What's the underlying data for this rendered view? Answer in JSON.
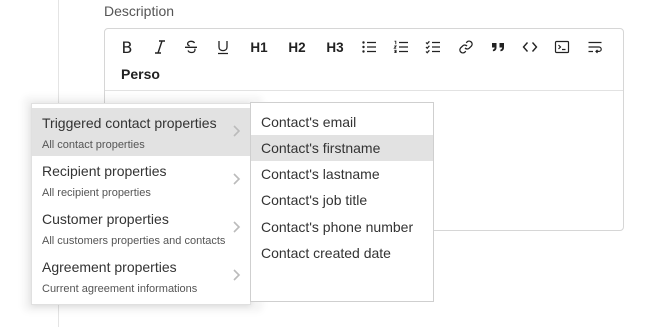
{
  "field": {
    "label": "Description"
  },
  "toolbar": {
    "buttons": [
      {
        "icon": "bold-icon",
        "label": "B"
      },
      {
        "icon": "italic-icon",
        "label": ""
      },
      {
        "icon": "strikethrough-icon",
        "label": ""
      },
      {
        "icon": "underline-icon",
        "label": ""
      },
      {
        "icon": "heading1",
        "label": "H1"
      },
      {
        "icon": "heading2",
        "label": "H2"
      },
      {
        "icon": "heading3",
        "label": "H3"
      },
      {
        "icon": "bullet-list-icon",
        "label": ""
      },
      {
        "icon": "numbered-list-icon",
        "label": ""
      },
      {
        "icon": "checklist-icon",
        "label": ""
      },
      {
        "icon": "link-icon",
        "label": ""
      },
      {
        "icon": "quote-icon",
        "label": ""
      },
      {
        "icon": "code-icon",
        "label": ""
      },
      {
        "icon": "code-block-icon",
        "label": ""
      },
      {
        "icon": "text-wrap-icon",
        "label": ""
      }
    ],
    "perso_label": "Perso"
  },
  "menu": {
    "items": [
      {
        "title": "Triggered contact properties",
        "subtitle": "All contact properties",
        "active": true
      },
      {
        "title": "Recipient properties",
        "subtitle": "All recipient properties",
        "active": false
      },
      {
        "title": "Customer properties",
        "subtitle": "All customers properties and contacts",
        "active": false
      },
      {
        "title": "Agreement properties",
        "subtitle": "Current agreement informations",
        "active": false
      }
    ]
  },
  "submenu": {
    "items": [
      {
        "label": "Contact's email",
        "active": false
      },
      {
        "label": "Contact's firstname",
        "active": true
      },
      {
        "label": "Contact's lastname",
        "active": false
      },
      {
        "label": "Contact's job title",
        "active": false
      },
      {
        "label": "Contact's phone number",
        "active": false
      },
      {
        "label": "Contact created date",
        "active": false
      }
    ]
  },
  "colors": {
    "highlight": "#e2e2e2",
    "border": "#d6d6d6",
    "text": "#333333"
  }
}
